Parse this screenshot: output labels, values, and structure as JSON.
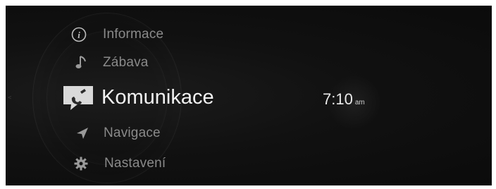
{
  "menu": {
    "items": [
      {
        "label": "Informace",
        "icon": "info-icon"
      },
      {
        "label": "Zábava",
        "icon": "music-note-icon"
      },
      {
        "label": "Komunikace",
        "icon": "phone-icon",
        "selected": true
      },
      {
        "label": "Navigace",
        "icon": "navigation-arrow-icon"
      },
      {
        "label": "Nastavení",
        "icon": "gear-icon"
      }
    ]
  },
  "clock": {
    "time": "7:10",
    "ampm": "am"
  },
  "colors": {
    "background": "#111111",
    "text_dim": "#8a8a8a",
    "text_selected": "#f2f2f2"
  }
}
